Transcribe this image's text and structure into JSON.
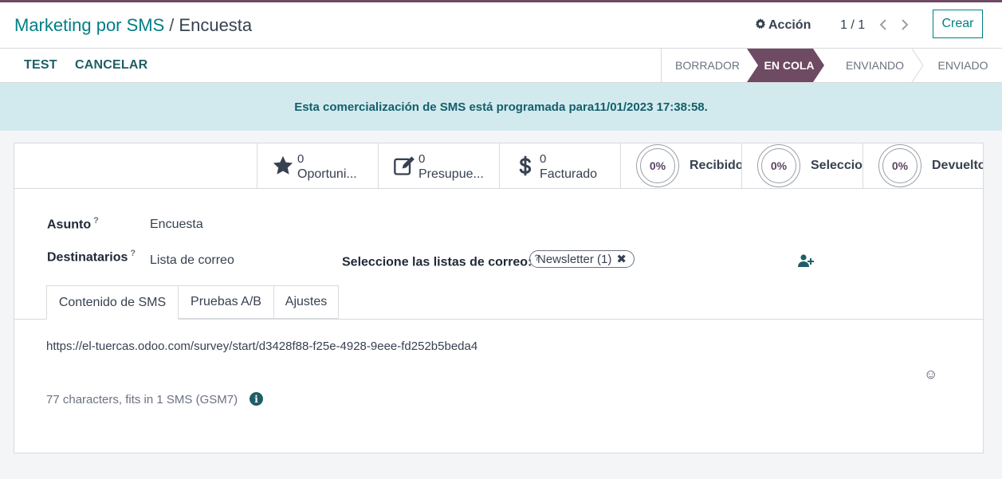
{
  "breadcrumb": {
    "parent": "Marketing por SMS",
    "separator": "/",
    "current": "Encuesta"
  },
  "toolbar": {
    "action_label": "Acción",
    "pager": "1 / 1",
    "create_label": "Crear"
  },
  "statusbar": {
    "buttons": [
      "TEST",
      "CANCELAR"
    ],
    "stages": [
      {
        "label": "BORRADOR",
        "active": false
      },
      {
        "label": "EN COLA",
        "active": true
      },
      {
        "label": "ENVIANDO",
        "active": false
      },
      {
        "label": "ENVIADO",
        "active": false
      }
    ]
  },
  "alert": "Esta comercialización de SMS está programada para11/01/2023 17:38:58.",
  "smart_buttons": [
    {
      "icon": "star-icon",
      "value": "0",
      "label": "Oportuni..."
    },
    {
      "icon": "edit-icon",
      "value": "0",
      "label": "Presupue..."
    },
    {
      "icon": "dollar-icon",
      "value": "0",
      "label": "Facturado"
    }
  ],
  "gauges": [
    {
      "value": "0%",
      "label": "Recibido"
    },
    {
      "value": "0%",
      "label": "Seleccior"
    },
    {
      "value": "0%",
      "label": "Devuelto"
    }
  ],
  "fields": {
    "subject_label": "Asunto",
    "subject_value": "Encuesta",
    "recipients_label": "Destinatarios",
    "recipients_value": "Lista de correo",
    "mailing_lists_label": "Seleccione las listas de correo:",
    "help_mark": "?",
    "mailing_list_tag": "Newsletter (1)",
    "tag_remove": "✖"
  },
  "tabs": [
    "Contenido de SMS",
    "Pruebas A/B",
    "Ajustes"
  ],
  "sms": {
    "body": "https://el-tuercas.odoo.com/survey/start/d3428f88-f25e-4928-9eee-fd252b5beda4",
    "emoji": "☺",
    "count": "77 characters, fits in 1 SMS (GSM7)",
    "info_glyph": "i"
  },
  "colors": {
    "accent": "#017e84",
    "active_stage": "#6f4a63",
    "alert_bg": "#d2eaee"
  }
}
